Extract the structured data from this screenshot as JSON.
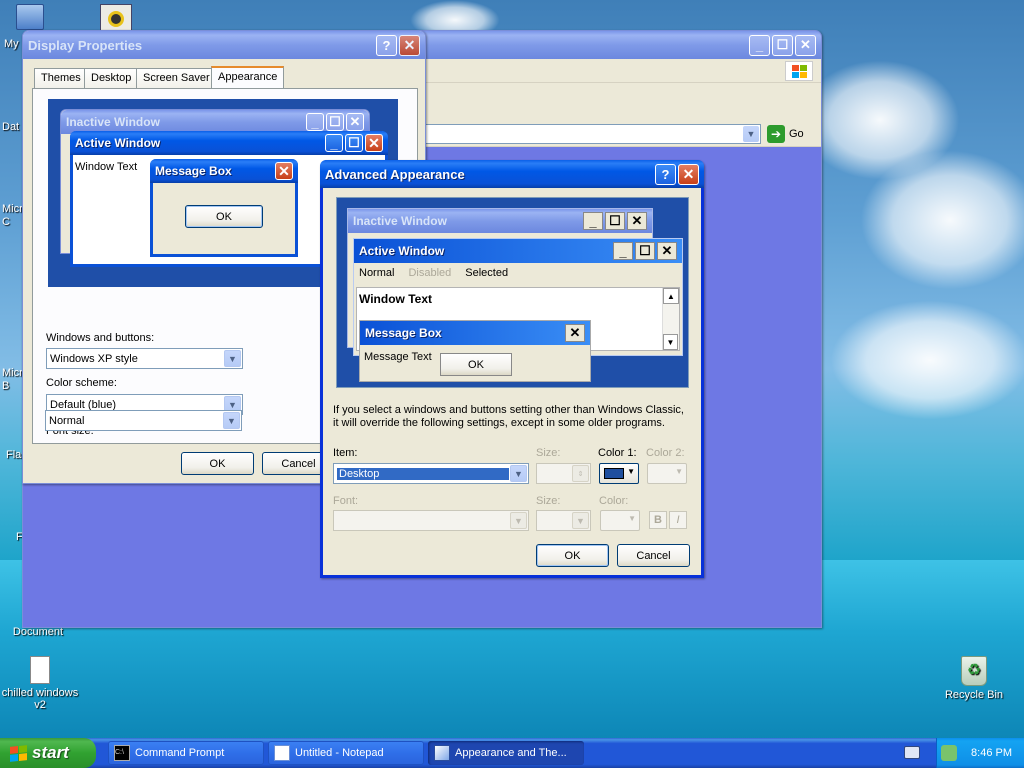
{
  "desktop": {
    "icons": [
      {
        "label": "My",
        "name": "my-computer"
      },
      {
        "label": "Dat",
        "name": "data"
      },
      {
        "label": "Micro C",
        "name": "microsoft-1"
      },
      {
        "label": "Micro B",
        "name": "microsoft-2"
      },
      {
        "label": "Flas",
        "name": "flash"
      },
      {
        "label": "F",
        "name": "f-item"
      },
      {
        "label": "Document",
        "name": "document"
      },
      {
        "label": "chilled windows v2",
        "name": "chilled-windows"
      },
      {
        "label": "Recycle Bin",
        "name": "recycle-bin"
      }
    ]
  },
  "browser": {
    "go_label": "Go"
  },
  "display_properties": {
    "title": "Display Properties",
    "tabs": [
      "Themes",
      "Desktop",
      "Screen Saver",
      "Appearance"
    ],
    "selected_tab": "Appearance",
    "preview": {
      "inactive_title": "Inactive Window",
      "active_title": "Active Window",
      "window_text": "Window Text",
      "msgbox_title": "Message Box",
      "ok": "OK"
    },
    "windows_buttons_label": "Windows and buttons:",
    "windows_buttons_value": "Windows XP style",
    "color_scheme_label": "Color scheme:",
    "color_scheme_value": "Default (blue)",
    "font_size_label": "Font size:",
    "font_size_value": "Normal",
    "ok": "OK",
    "cancel": "Cancel"
  },
  "advanced_appearance": {
    "title": "Advanced Appearance",
    "preview": {
      "inactive_title": "Inactive Window",
      "active_title": "Active Window",
      "menu_normal": "Normal",
      "menu_disabled": "Disabled",
      "menu_selected": "Selected",
      "window_text": "Window Text",
      "msgbox_title": "Message Box",
      "msgbox_text": "Message Text",
      "ok": "OK"
    },
    "info_line1": "If you select a windows and buttons setting other than Windows Classic,",
    "info_line2": "it will override the following settings, except in some older programs.",
    "item_label": "Item:",
    "item_value": "Desktop",
    "size_label": "Size:",
    "color1_label": "Color 1:",
    "color1_value": "#1f4f9f",
    "color2_label": "Color 2:",
    "font_label": "Font:",
    "font_size_label": "Size:",
    "font_color_label": "Color:",
    "bold_label": "B",
    "italic_label": "I",
    "ok": "OK",
    "cancel": "Cancel"
  },
  "taskbar": {
    "start_label": "start",
    "tasks": [
      {
        "label": "Command Prompt"
      },
      {
        "label": "Untitled - Notepad"
      },
      {
        "label": "Appearance and The..."
      }
    ],
    "clock": "8:46 PM"
  },
  "colors": {
    "desktop_preview_blue": "#1f4fa8",
    "xp_title_blue": "#0058e6",
    "lavender_panel": "#6e78e4"
  }
}
